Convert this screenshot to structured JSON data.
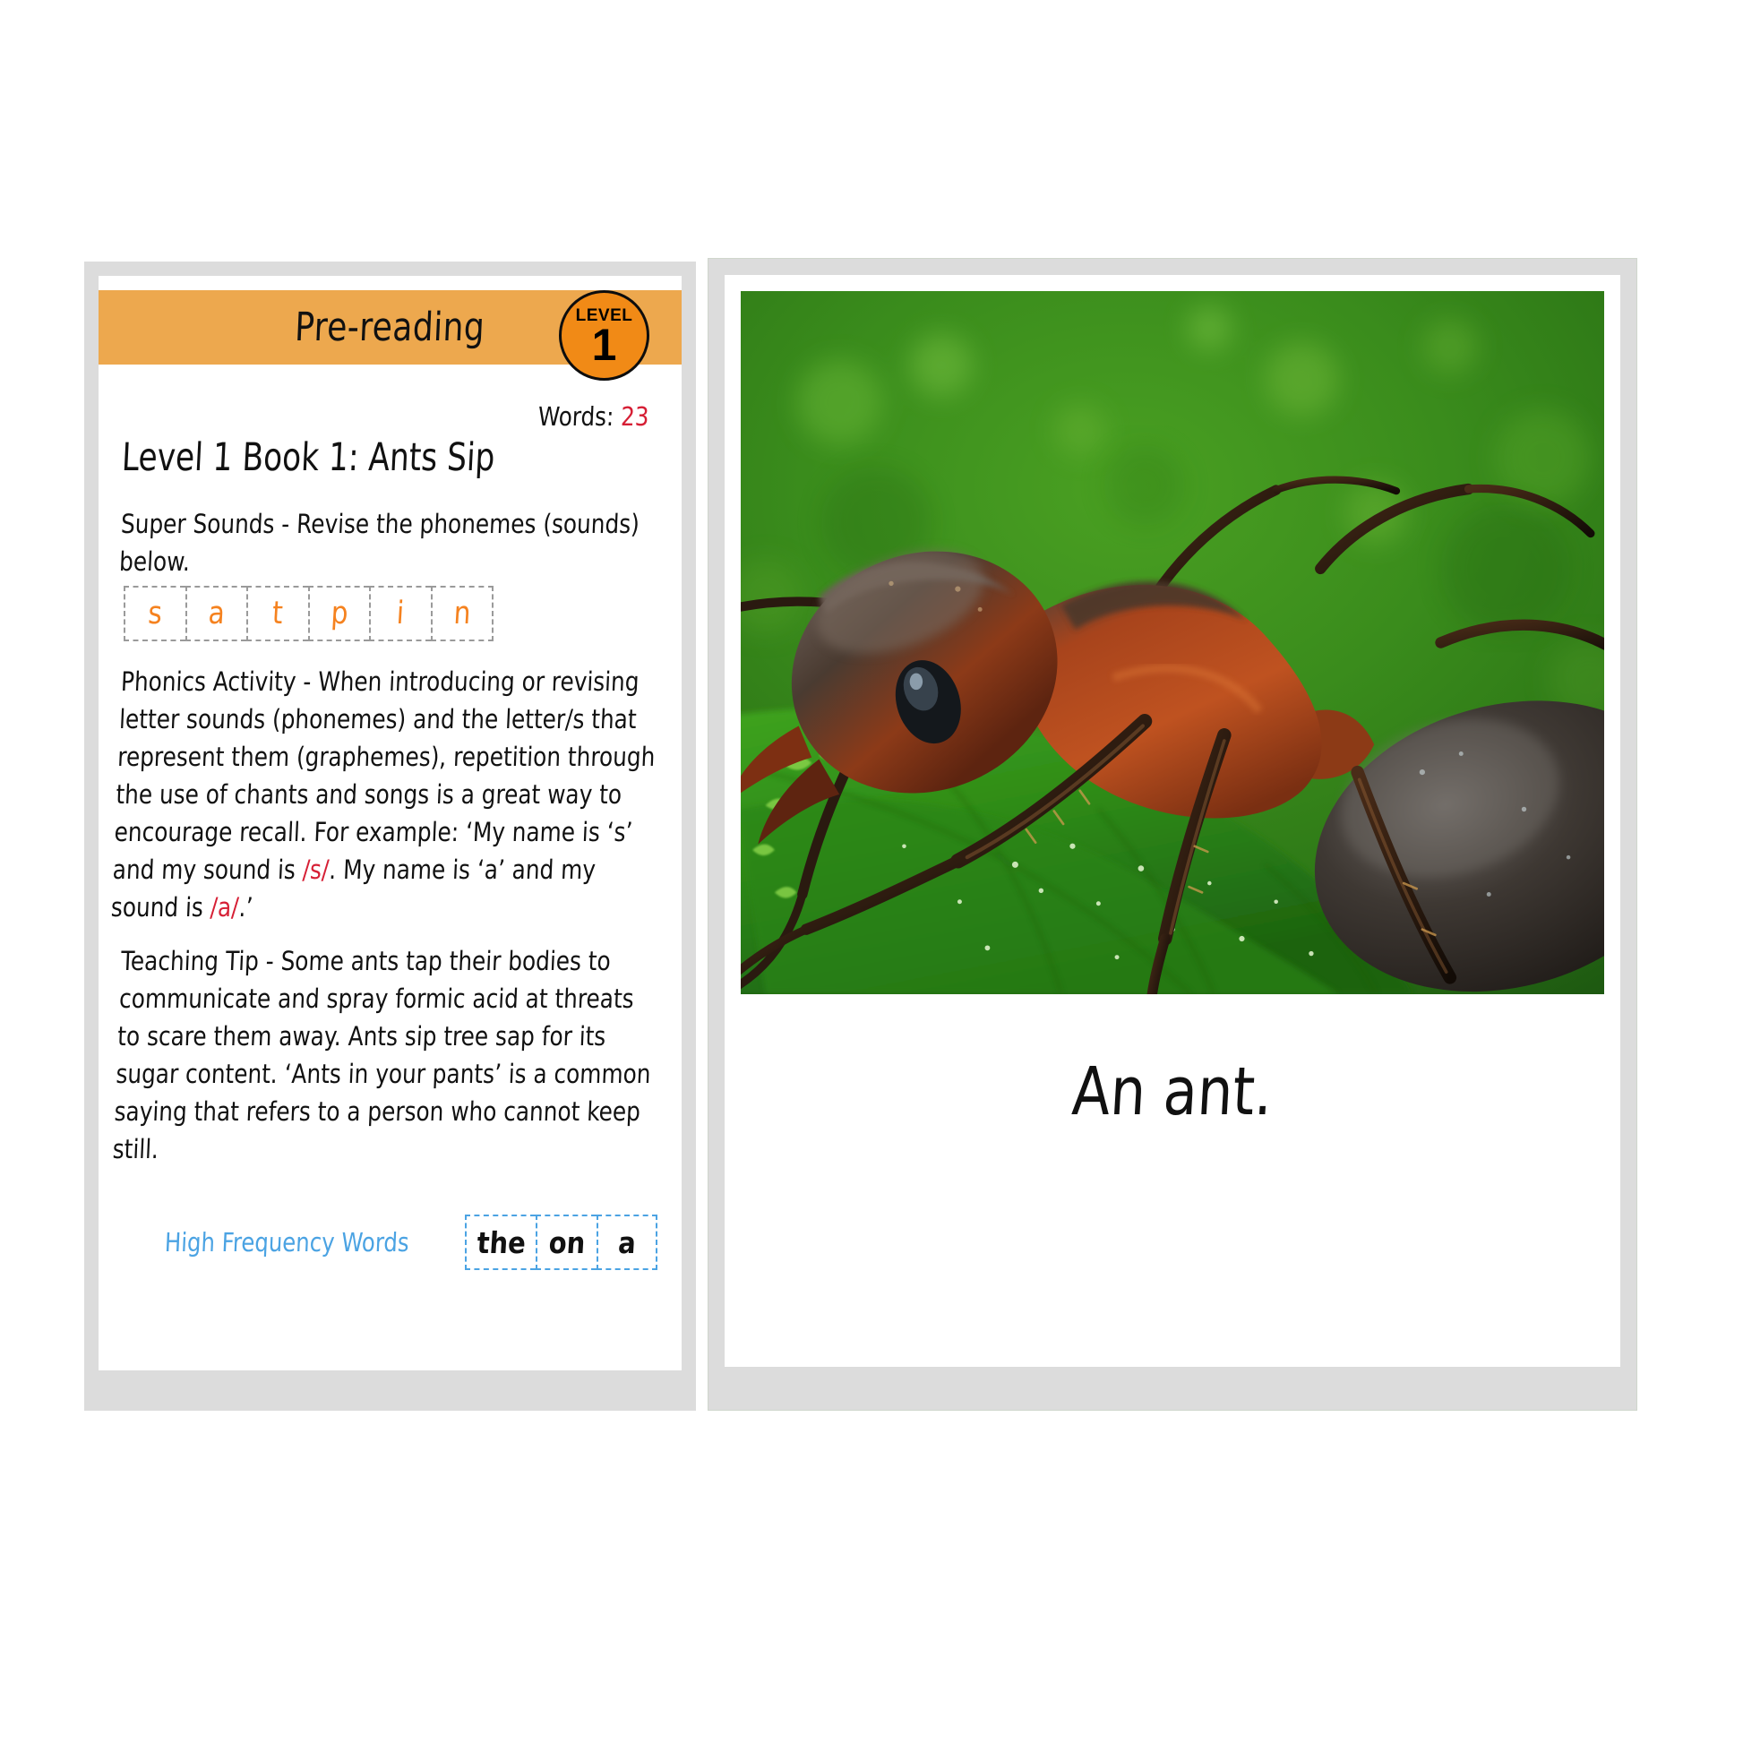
{
  "page": {
    "background_color": "#ffffff",
    "card_border_color": "#dcdcdc"
  },
  "teacher_card": {
    "header": {
      "title": "Pre-reading",
      "background_color": "#eda84e",
      "badge": {
        "word": "LEVEL",
        "number": "1",
        "fill_color": "#f18a16",
        "border_color": "#0d0d0d"
      }
    },
    "words_counter": {
      "label": "Words:",
      "count": "23",
      "count_color": "#d61f35"
    },
    "book_title": "Level 1 Book 1: Ants Sip",
    "super_sounds": {
      "instruction": "Super Sounds - Revise the phonemes (sounds) below.",
      "phonemes": [
        "s",
        "a",
        "t",
        "p",
        "i",
        "n"
      ],
      "letter_color": "#f5821f",
      "box_border_color": "#9a9a9a"
    },
    "phonics_activity": {
      "part1": "Phonics Activity - When introducing or revising letter sounds (phonemes) and the letter/s that represent them (graphemes), repetition through the use of chants and songs is a great way to encourage recall. For example: ‘My name is ‘s’ and my sound is ",
      "sound_s": "/s/",
      "part2": ". My name is ‘a’ and my sound is ",
      "sound_a": "/a/",
      "part3": ".’"
    },
    "teaching_tip": "Teaching Tip - Some ants tap their bodies to communicate and spray formic acid at threats to scare them away. Ants sip tree sap for its sugar content. ‘Ants in your pants’ is a common saying that refers to a person who cannot keep still.",
    "high_frequency_words": {
      "label": "High Frequency Words",
      "label_color": "#4ba3e3",
      "words": [
        "the",
        "on",
        "a"
      ],
      "box_border_color": "#4ba3e3"
    }
  },
  "book_card": {
    "photo": {
      "subject": "red wood ant on a green leaf",
      "alt": "Macro photograph of a red and black ant standing on a dewy green leaf",
      "background_color": "#2e7d1e",
      "ant_body_color": "#a6391a",
      "ant_dark_color": "#2b2420"
    },
    "caption": "An ant."
  }
}
